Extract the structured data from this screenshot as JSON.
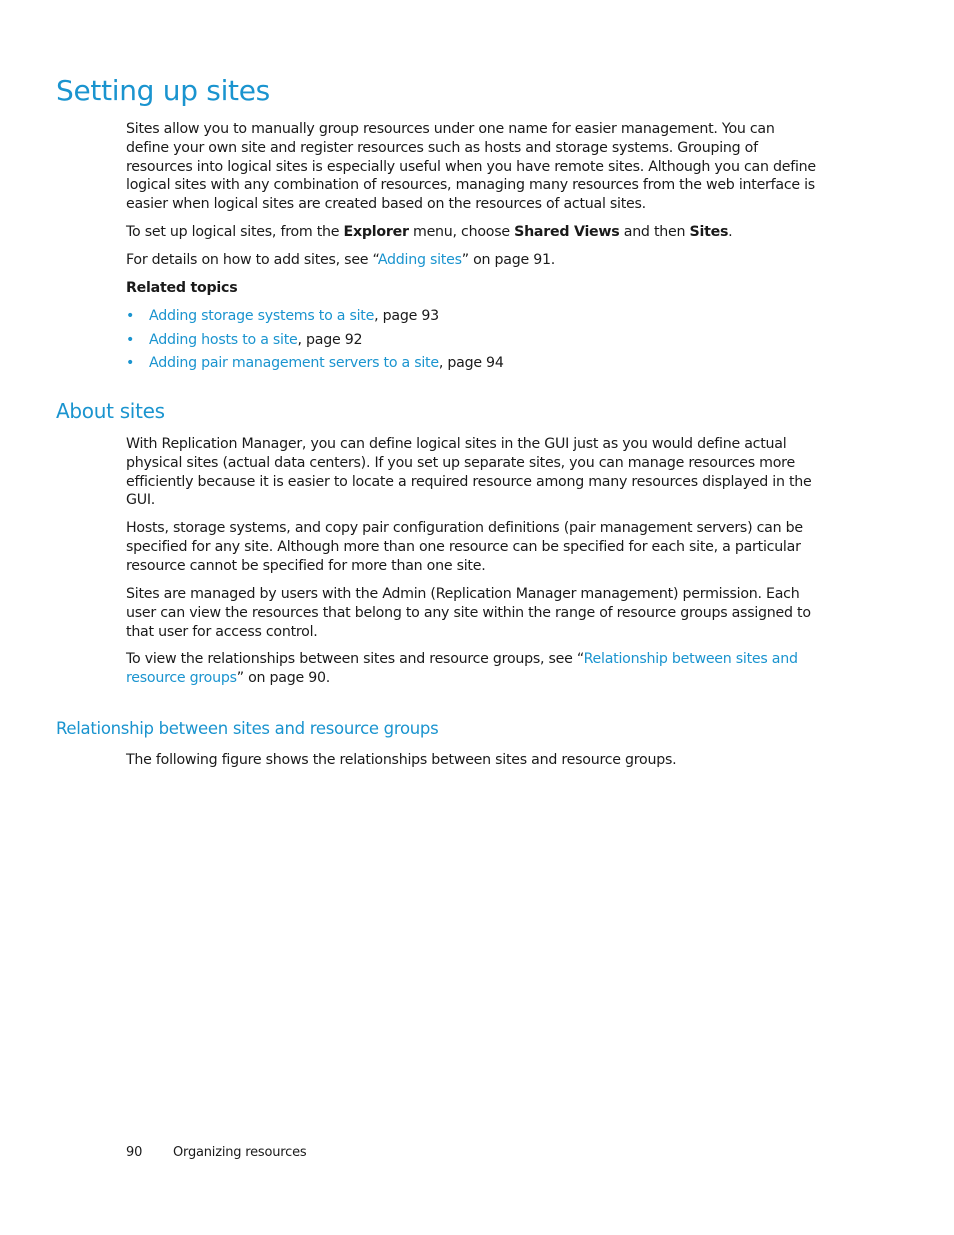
{
  "sections": {
    "setting_up": {
      "title": "Setting up sites",
      "intro": "Sites allow you to manually group resources under one name for easier management. You can define your own site and register resources such as hosts and storage systems. Grouping of resources into logical sites is especially useful when you have remote sites. Although you can define logical sites with any combination of resources, managing many resources from the web interface is easier when logical sites are created based on the resources of actual sites.",
      "steps": {
        "prefix": "To set up logical sites, from the ",
        "menu": "Explorer",
        "mid1": " menu, choose ",
        "item1": "Shared Views",
        "mid2": " and then ",
        "item2": "Sites",
        "suffix": "."
      },
      "details": {
        "prefix": " For details on how to add sites, see “",
        "link": "Adding sites",
        "suffix": "” on page 91."
      },
      "related_heading": "Related topics",
      "related": [
        {
          "link": "Adding storage systems to a site",
          "suffix": ", page 93"
        },
        {
          "link": "Adding hosts to a site",
          "suffix": ", page 92"
        },
        {
          "link": "Adding pair management servers to a site",
          "suffix": ", page 94"
        }
      ],
      "bullet": "•"
    },
    "about": {
      "title": "About sites",
      "p1": "With Replication Manager, you can define logical sites in the GUI just as you would define actual physical sites (actual data centers). If you set up separate sites, you can manage resources more efficiently because it is easier to locate a required resource among many resources displayed in the GUI.",
      "p2": "Hosts, storage systems, and copy pair configuration definitions (pair management servers) can be specified for any site. Although more than one resource can be specified for each site, a particular resource cannot be specified for more than one site.",
      "p3": "Sites are managed by users with the Admin (Replication Manager management) permission. Each user can view the resources that belong to any site within the range of resource groups assigned to that user for access control.",
      "p4": {
        "prefix": "To view the relationships between sites and resource groups, see “",
        "link": "Relationship between sites and resource groups",
        "suffix": "” on page 90."
      }
    },
    "relationship": {
      "title": "Relationship between sites and resource groups",
      "p1": "The following figure shows the relationships between sites and resource groups."
    }
  },
  "footer": {
    "page_number": "90",
    "chapter": "Organizing resources"
  },
  "colors": {
    "accent": "#1a94cf",
    "text": "#1a1a1a"
  }
}
